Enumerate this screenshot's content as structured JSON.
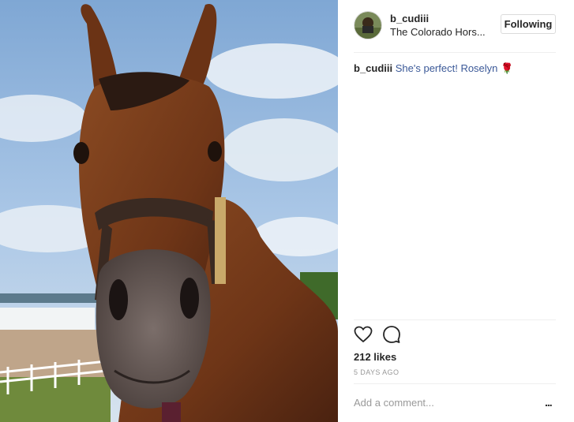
{
  "post": {
    "username": "b_cudiii",
    "location": "The Colorado Hors...",
    "follow_label": "Following",
    "caption_user": "b_cudiii",
    "caption_text": "She's perfect! Roselyn 🌹",
    "likes": "212 likes",
    "timestamp": "5 DAYS AGO",
    "comment_placeholder": "Add a comment...",
    "more_label": "...",
    "image_subject": "close-up of a bay horse wearing a leather halter under a blue sky"
  },
  "icons": [
    "heart-icon",
    "comment-icon",
    "more-options-icon"
  ],
  "colors": {
    "link": "#3b5998",
    "border": "#dbdbdb",
    "muted": "#999999"
  }
}
